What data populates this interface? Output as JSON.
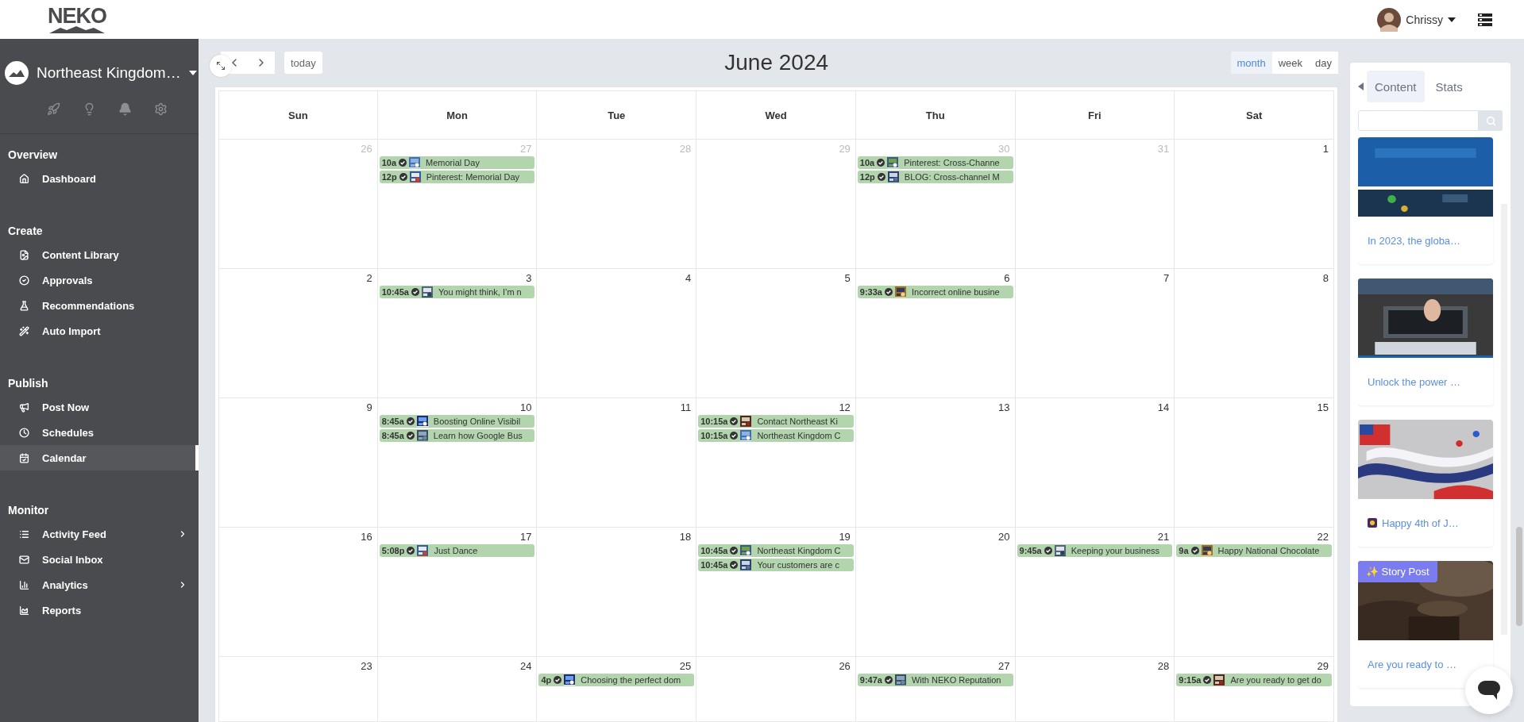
{
  "header": {
    "logo": "NEKO",
    "user": {
      "name": "Chrissy"
    }
  },
  "sidebar": {
    "account": "Northeast Kingdom…",
    "sections": [
      {
        "title": "Overview",
        "items": [
          {
            "label": "Dashboard",
            "selected": false,
            "has_submenu": false
          }
        ]
      },
      {
        "title": "Create",
        "items": [
          {
            "label": "Content Library",
            "selected": false,
            "has_submenu": false
          },
          {
            "label": "Approvals",
            "selected": false,
            "has_submenu": false
          },
          {
            "label": "Recommendations",
            "selected": false,
            "has_submenu": false
          },
          {
            "label": "Auto Import",
            "selected": false,
            "has_submenu": false
          }
        ]
      },
      {
        "title": "Publish",
        "items": [
          {
            "label": "Post Now",
            "selected": false,
            "has_submenu": false
          },
          {
            "label": "Schedules",
            "selected": false,
            "has_submenu": false
          },
          {
            "label": "Calendar",
            "selected": true,
            "has_submenu": false
          }
        ]
      },
      {
        "title": "Monitor",
        "items": [
          {
            "label": "Activity Feed",
            "selected": false,
            "has_submenu": true
          },
          {
            "label": "Social Inbox",
            "selected": false,
            "has_submenu": false
          },
          {
            "label": "Analytics",
            "selected": false,
            "has_submenu": true
          },
          {
            "label": "Reports",
            "selected": false,
            "has_submenu": false
          }
        ]
      }
    ]
  },
  "toolbar": {
    "today": "today",
    "title": "June 2024",
    "views": [
      {
        "label": "month",
        "selected": true
      },
      {
        "label": "week",
        "selected": false
      },
      {
        "label": "day",
        "selected": false
      }
    ]
  },
  "calendar": {
    "weekdays": [
      "Sun",
      "Mon",
      "Tue",
      "Wed",
      "Thu",
      "Fri",
      "Sat"
    ],
    "weeks": [
      {
        "days": [
          {
            "date": "26",
            "outside": true
          },
          {
            "date": "27",
            "outside": true,
            "events": [
              {
                "time": "10a",
                "title": "Memorial Day"
              },
              {
                "time": "12p",
                "title": "Pinterest: Memorial Day"
              }
            ]
          },
          {
            "date": "28",
            "outside": true
          },
          {
            "date": "29",
            "outside": true
          },
          {
            "date": "30",
            "outside": true,
            "events": [
              {
                "time": "10a",
                "title": "Pinterest: Cross-Channe"
              },
              {
                "time": "12p",
                "title": "BLOG: Cross-channel M"
              }
            ]
          },
          {
            "date": "31",
            "outside": true
          },
          {
            "date": "1",
            "outside": false
          }
        ]
      },
      {
        "days": [
          {
            "date": "2",
            "outside": false
          },
          {
            "date": "3",
            "outside": false,
            "events": [
              {
                "time": "10:45a",
                "title": "You might think, I’m n"
              }
            ]
          },
          {
            "date": "4",
            "outside": false
          },
          {
            "date": "5",
            "outside": false
          },
          {
            "date": "6",
            "outside": false,
            "events": [
              {
                "time": "9:33a",
                "title": "Incorrect online busine"
              }
            ]
          },
          {
            "date": "7",
            "outside": false
          },
          {
            "date": "8",
            "outside": false
          }
        ]
      },
      {
        "days": [
          {
            "date": "9",
            "outside": false
          },
          {
            "date": "10",
            "outside": false,
            "events": [
              {
                "time": "8:45a",
                "title": "Boosting Online Visibil"
              },
              {
                "time": "8:45a",
                "title": "Learn how Google Bus"
              }
            ]
          },
          {
            "date": "11",
            "outside": false
          },
          {
            "date": "12",
            "outside": false,
            "events": [
              {
                "time": "10:15a",
                "title": "Contact Northeast Ki"
              },
              {
                "time": "10:15a",
                "title": "Northeast Kingdom C"
              }
            ]
          },
          {
            "date": "13",
            "outside": false
          },
          {
            "date": "14",
            "outside": false
          },
          {
            "date": "15",
            "outside": false
          }
        ]
      },
      {
        "days": [
          {
            "date": "16",
            "outside": false
          },
          {
            "date": "17",
            "outside": false,
            "events": [
              {
                "time": "5:08p",
                "title": "Just Dance"
              }
            ]
          },
          {
            "date": "18",
            "outside": false
          },
          {
            "date": "19",
            "outside": false,
            "events": [
              {
                "time": "10:45a",
                "title": "Northeast Kingdom C"
              },
              {
                "time": "10:45a",
                "title": "Your customers are c"
              }
            ]
          },
          {
            "date": "20",
            "outside": false
          },
          {
            "date": "21",
            "outside": false,
            "events": [
              {
                "time": "9:45a",
                "title": "Keeping your business"
              }
            ]
          },
          {
            "date": "22",
            "outside": false,
            "events": [
              {
                "time": "9a",
                "title": "Happy National Chocolate"
              }
            ]
          }
        ]
      },
      {
        "days": [
          {
            "date": "23",
            "outside": false
          },
          {
            "date": "24",
            "outside": false
          },
          {
            "date": "25",
            "outside": false,
            "events": [
              {
                "time": "4p",
                "title": "Choosing the perfect dom"
              }
            ]
          },
          {
            "date": "26",
            "outside": false
          },
          {
            "date": "27",
            "outside": false,
            "events": [
              {
                "time": "9:47a",
                "title": "With NEKO Reputation"
              }
            ]
          },
          {
            "date": "28",
            "outside": false
          },
          {
            "date": "29",
            "outside": false,
            "events": [
              {
                "time": "9:15a",
                "title": "Are you ready to get do"
              }
            ]
          }
        ]
      }
    ]
  },
  "panel": {
    "tabs": [
      {
        "label": "Content",
        "selected": true
      },
      {
        "label": "Stats",
        "selected": false
      }
    ],
    "cards": [
      {
        "kind": "post",
        "caption": "In 2023, the globa…",
        "prefix_icon": false
      },
      {
        "kind": "post",
        "caption": "Unlock the power …",
        "prefix_icon": false
      },
      {
        "kind": "post",
        "caption": "Happy 4th of J…",
        "prefix_icon": true
      },
      {
        "kind": "story",
        "badge": "✨ Story Post",
        "caption": "Are you ready to …",
        "prefix_icon": false
      }
    ]
  }
}
